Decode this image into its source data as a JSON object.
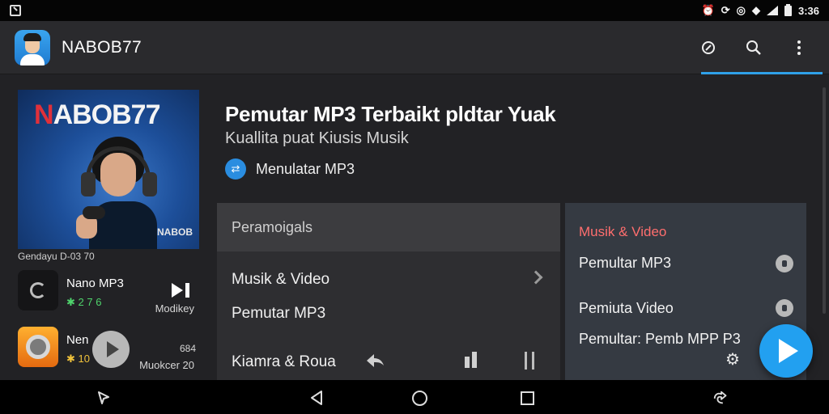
{
  "statusbar": {
    "time": "3:36",
    "icons": [
      "notification-icon",
      "alarm-icon",
      "sync-icon",
      "target-icon",
      "wifi-icon",
      "signal-icon",
      "battery-icon"
    ]
  },
  "appbar": {
    "title": "NABOB77",
    "actions": [
      "cast-icon",
      "search-icon",
      "more-vert-icon"
    ],
    "accent": "#2fa0e8"
  },
  "cover": {
    "title_red": "N",
    "title_rest": "ABOB77",
    "brand": "NABOB",
    "caption": "Gendayu​ D-03 70"
  },
  "mini_items": [
    {
      "title": "Nano MP3",
      "meta": "✱ 2 7 6",
      "sub": "Modikey"
    },
    {
      "title": "Nen",
      "meta": "✱ 10",
      "side": "684",
      "sub": "Muokcer 20"
    }
  ],
  "main": {
    "title": "Pemutar MP3 Terbaikt pldtar Yuak",
    "subtitle": "Kuallita puat Kiusis Musik",
    "badge_label": "Menulatar MP3"
  },
  "panel_center": {
    "header": "Peramoigals",
    "rows": [
      "Musik & Video",
      "Pemutar MP3",
      "Kiamra & Roua"
    ]
  },
  "panel_right": {
    "header": "Musik & Video",
    "items": [
      "Pemultar MP3",
      "Pemiuta Video",
      "Pemultar: Pemb MPP P3"
    ],
    "header_color": "#ff6e6e"
  },
  "navbar": {
    "buttons": [
      "screenshot-icon",
      "back-icon",
      "home-icon",
      "recents-icon",
      "gesture-icon"
    ]
  }
}
